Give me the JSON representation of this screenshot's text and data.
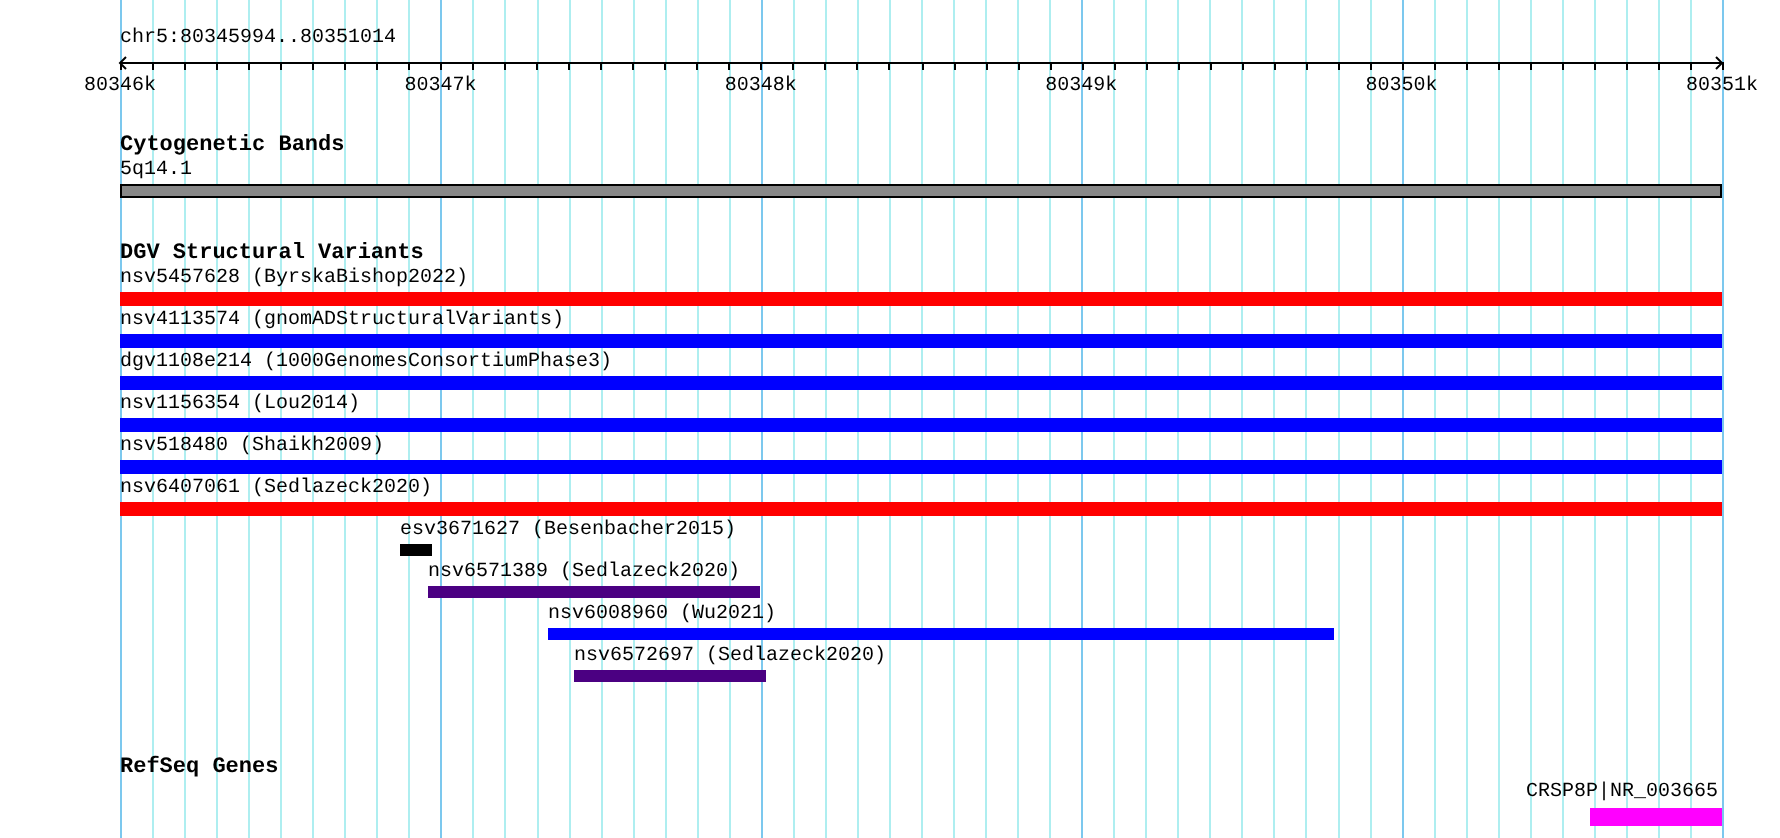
{
  "location": "chr5:80345994..80351014",
  "ruler": {
    "ticks": [
      "80346k",
      "80347k",
      "80348k",
      "80349k",
      "80350k",
      "80351k"
    ]
  },
  "tracks": [
    {
      "kind": "cytoband",
      "title": "Cytogenetic Bands",
      "features": [
        {
          "label": "5q14.1"
        }
      ]
    },
    {
      "kind": "variants",
      "title": "DGV Structural Variants",
      "features": [
        {
          "label": "nsv5457628 (ByrskaBishop2022)",
          "color": "#ff0000"
        },
        {
          "label": "nsv4113574 (gnomADStructuralVariants)",
          "color": "#0000ff"
        },
        {
          "label": "dgv1108e214 (1000GenomesConsortiumPhase3)",
          "color": "#0000ff"
        },
        {
          "label": "nsv1156354 (Lou2014)",
          "color": "#0000ff"
        },
        {
          "label": "nsv518480 (Shaikh2009)",
          "color": "#0000ff"
        },
        {
          "label": "nsv6407061 (Sedlazeck2020)",
          "color": "#ff0000"
        },
        {
          "label": "esv3671627 (Besenbacher2015)",
          "color": "#000000"
        },
        {
          "label": "nsv6571389 (Sedlazeck2020)",
          "color": "#4b0082"
        },
        {
          "label": "nsv6008960 (Wu2021)",
          "color": "#0000ff"
        },
        {
          "label": "nsv6572697 (Sedlazeck2020)",
          "color": "#4b0082"
        }
      ]
    },
    {
      "kind": "genes",
      "title": "RefSeq Genes",
      "features": [
        {
          "label": "CRSP8P|NR_003665",
          "color": "#ff00ff"
        }
      ]
    }
  ]
}
